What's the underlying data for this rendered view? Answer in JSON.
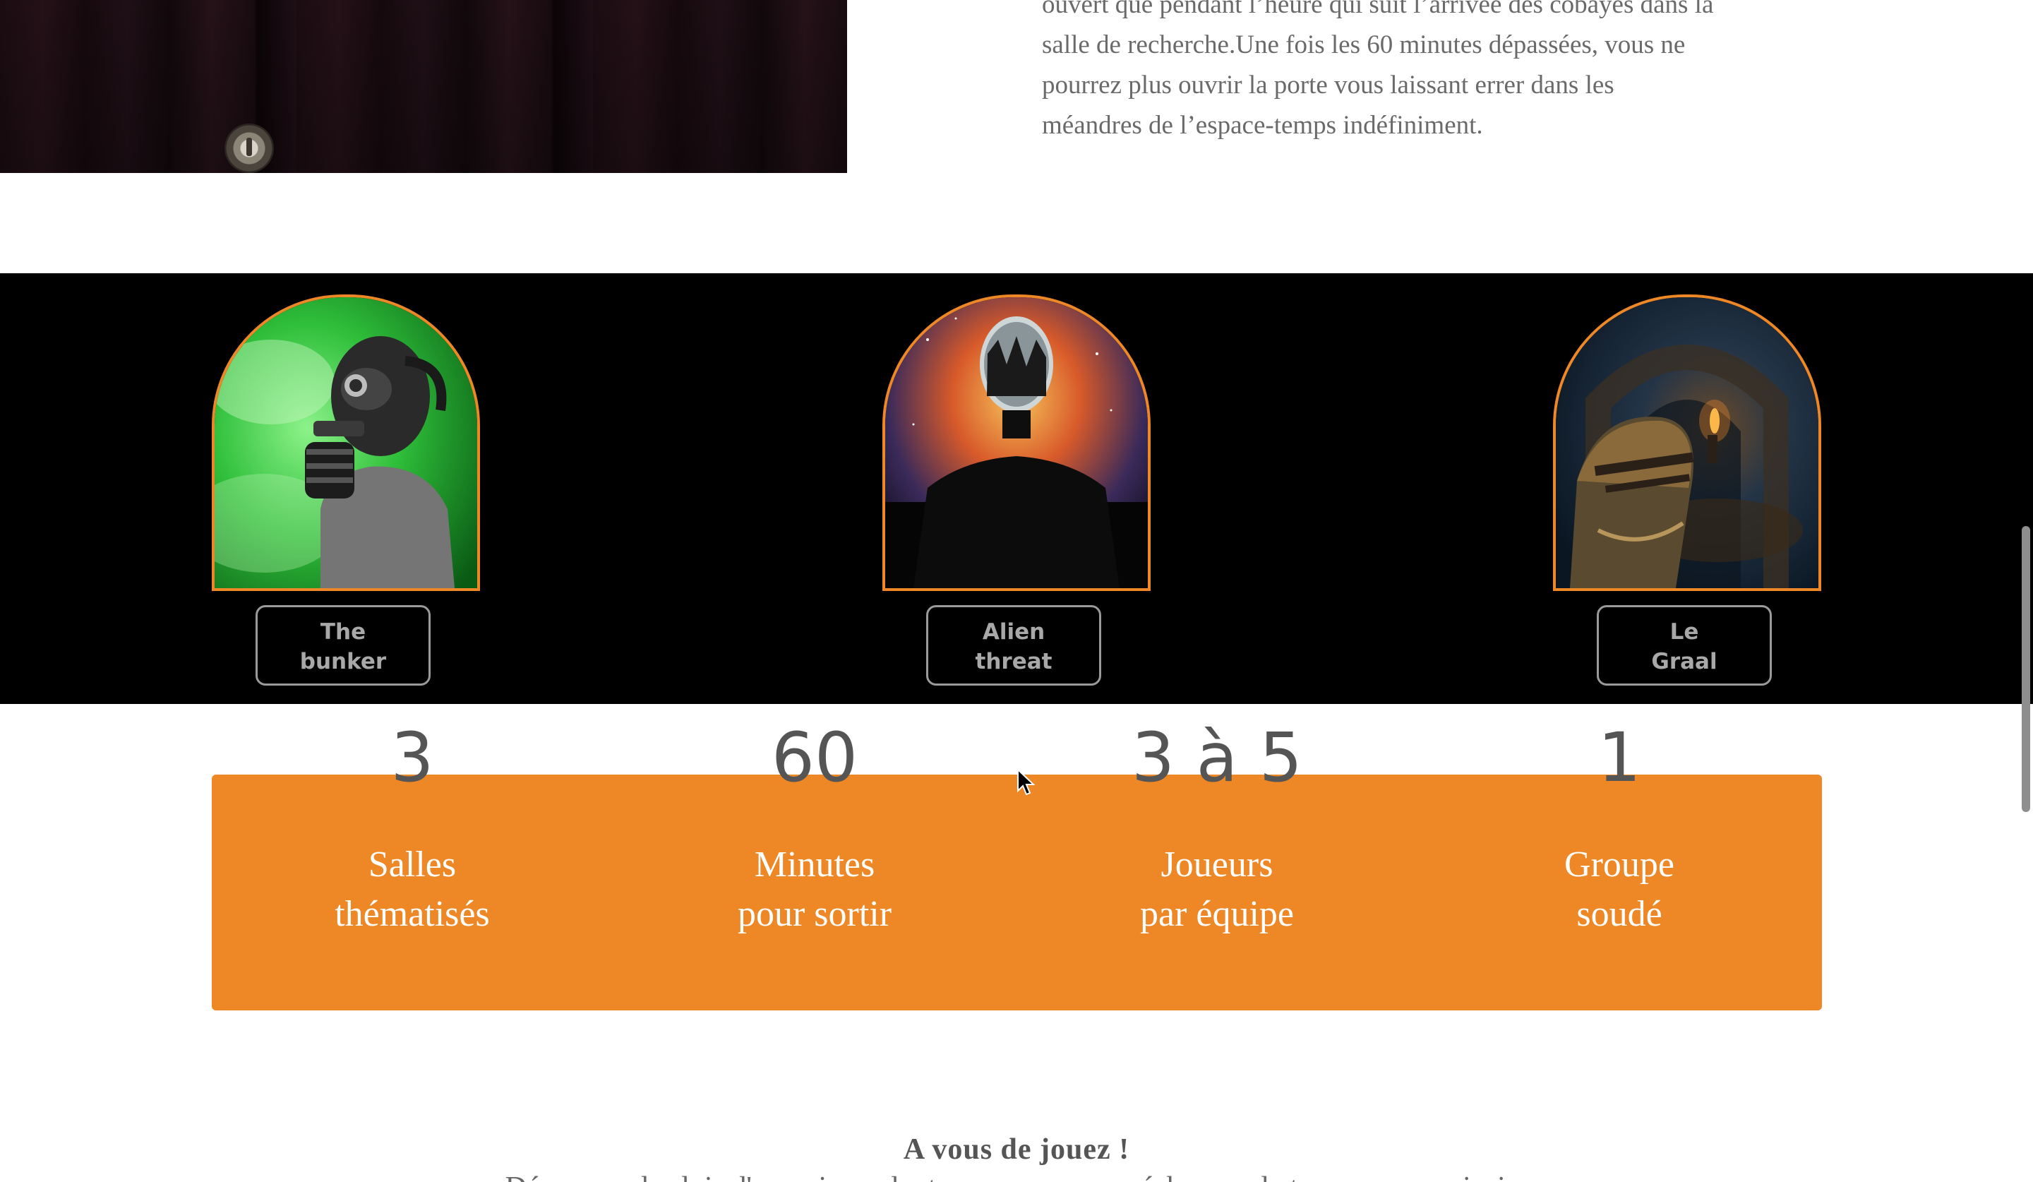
{
  "intro": {
    "lines": [
      "ouvert que pendant l’heure qui suit l’arrivée des cobayes dans la",
      "salle de recherche.Une fois les 60 minutes dépassées, vous ne",
      "pourrez plus ouvrir la porte vous laissant errer dans les",
      "méandres de l’espace-temps indéfiniment."
    ]
  },
  "rooms": [
    {
      "line1": "The",
      "line2": "bunker"
    },
    {
      "line1": "Alien",
      "line2": "threat"
    },
    {
      "line1": "Le",
      "line2": "Graal"
    }
  ],
  "stats": [
    {
      "number": "3",
      "label1": "Salles",
      "label2": "thématisés"
    },
    {
      "number": "60",
      "label1": "Minutes",
      "label2": "pour sortir"
    },
    {
      "number": "3 à 5",
      "label1": "Joueurs",
      "label2": "par équipe"
    },
    {
      "number": "1",
      "label1": "Groupe",
      "label2": "soudé"
    }
  ],
  "cta": {
    "title": "A vous de jouez !",
    "subtitle": "Découvrez les lois d'un univers dont vous ne pourrez échapper, le temps presse ainsi..."
  },
  "colors": {
    "accent": "#ee8726",
    "dark_band": "#000000",
    "text_gray": "#6a6a6a"
  }
}
